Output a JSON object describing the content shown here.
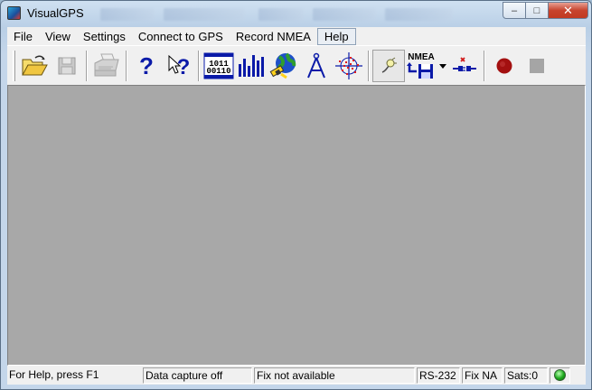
{
  "window": {
    "title": "VisualGPS",
    "caption_buttons": {
      "minimize": "–",
      "maximize": "□",
      "close": "✕"
    }
  },
  "menubar": {
    "items": [
      "File",
      "View",
      "Settings",
      "Connect to GPS",
      "Record NMEA",
      "Help"
    ],
    "active": "Help"
  },
  "toolbar": {
    "buttons": [
      {
        "name": "open-button",
        "icon": "folder-open-icon",
        "enabled": true
      },
      {
        "name": "save-button",
        "icon": "floppy-disk-icon",
        "enabled": false
      },
      {
        "name": "print-button",
        "icon": "printer-icon",
        "enabled": false
      },
      {
        "name": "help-button",
        "icon": "question-mark-icon",
        "enabled": true
      },
      {
        "name": "context-help-button",
        "icon": "pointer-question-icon",
        "enabled": true
      },
      {
        "name": "binary-view-button",
        "icon": "binary-data-icon",
        "enabled": true
      },
      {
        "name": "signal-level-button",
        "icon": "bar-chart-icon",
        "enabled": true
      },
      {
        "name": "satellite-azimuth-button",
        "icon": "globe-satellite-icon",
        "enabled": true
      },
      {
        "name": "survey-button",
        "icon": "compass-divider-icon",
        "enabled": true
      },
      {
        "name": "position-scatter-button",
        "icon": "scatter-crosshair-icon",
        "enabled": true
      },
      {
        "name": "probe-button",
        "icon": "probe-icon",
        "enabled": true,
        "pressed": true
      },
      {
        "name": "nmea-record-button",
        "icon": "nmea-save-icon",
        "enabled": true,
        "label": "NMEA"
      },
      {
        "name": "disconnect-button",
        "icon": "disconnect-plug-icon",
        "enabled": true
      },
      {
        "name": "record-button",
        "icon": "record-circle-icon",
        "enabled": true
      },
      {
        "name": "stop-button",
        "icon": "stop-square-icon",
        "enabled": false
      }
    ]
  },
  "statusbar": {
    "help_text": "For Help, press F1",
    "capture_status": "Data capture off",
    "fix_status": "Fix not available",
    "port": "RS-232",
    "fix_type": "Fix NA",
    "sats": "Sats:0",
    "indicator_color": "#1ca81c"
  },
  "colors": {
    "client_background": "#a8a8a8",
    "chrome": "#f0f0f0",
    "toolbar_blue": "#0a1aa8",
    "record_red": "#a31010"
  }
}
